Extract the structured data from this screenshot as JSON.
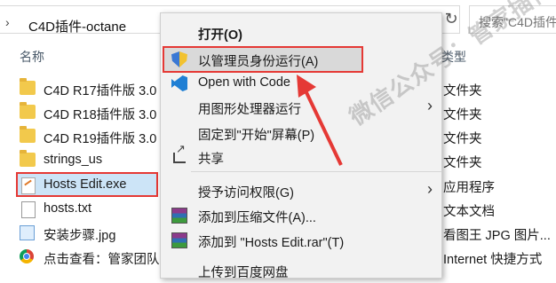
{
  "address": {
    "path": "C4D插件-octane"
  },
  "search": {
    "placeholder": "搜索\"C4D插件"
  },
  "columns": {
    "name": "名称",
    "type": "类型"
  },
  "files": [
    {
      "name": "C4D R17插件版 3.0",
      "type": "文件夹",
      "icon": "folder-icon"
    },
    {
      "name": "C4D R18插件版 3.0",
      "type": "文件夹",
      "icon": "folder-icon"
    },
    {
      "name": "C4D R19插件版 3.0",
      "type": "文件夹",
      "icon": "folder-icon"
    },
    {
      "name": "strings_us",
      "type": "文件夹",
      "icon": "folder-icon"
    },
    {
      "name": "Hosts Edit.exe",
      "type": "应用程序",
      "icon": "exe-icon"
    },
    {
      "name": "hosts.txt",
      "type": "文本文档",
      "icon": "text-file-icon"
    },
    {
      "name": "安装步骤.jpg",
      "type": "看图王 JPG 图片...",
      "icon": "image-file-icon"
    },
    {
      "name": "点击查看：管家团队",
      "type": "Internet 快捷方式",
      "icon": "chrome-icon"
    }
  ],
  "context_menu": {
    "open": "打开(O)",
    "run_as_admin": "以管理员身份运行(A)",
    "open_with_code": "Open with Code",
    "gpu_run": "用图形处理器运行",
    "pin_start": "固定到\"开始\"屏幕(P)",
    "share": "共享",
    "grant_access": "授予访问权限(G)",
    "add_archive": "添加到压缩文件(A)...",
    "add_rar": "添加到 \"Hosts Edit.rar\"(T)",
    "upload": "上传到百度网盘"
  },
  "watermark": "微信公众号：管家插件",
  "colors": {
    "highlight": "#e53935",
    "selection": "#cce4f7",
    "menu_bg": "#f2f2f2"
  }
}
